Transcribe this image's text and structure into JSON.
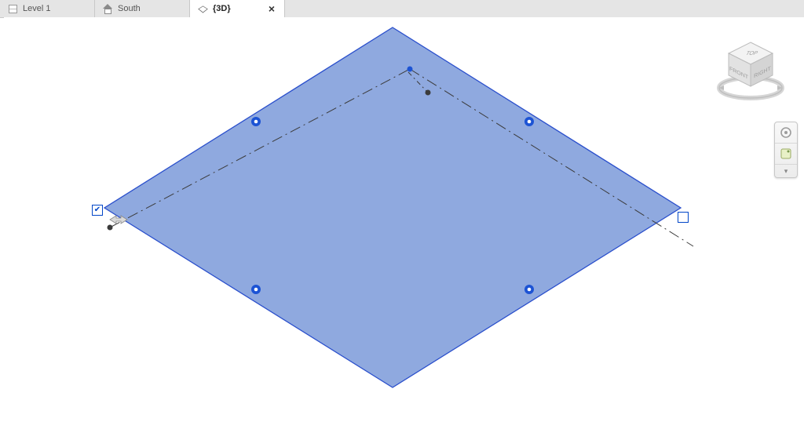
{
  "tabs": [
    {
      "label": "Level 1",
      "icon": "plan",
      "active": false
    },
    {
      "label": "South",
      "icon": "elev",
      "active": false
    },
    {
      "label": "{3D}",
      "icon": "3d",
      "active": true,
      "closeable": true
    }
  ],
  "viewcube": {
    "faces": {
      "top": "TOP",
      "front": "FRONT",
      "right": "RIGHT"
    }
  },
  "navbar": {
    "home_tip": "Home",
    "wheel_tip": "Full Navigation Wheel",
    "expand_tip": "Expand"
  },
  "selection": {
    "checkbox_left_checked": true,
    "checkbox_right_checked": false
  },
  "colors": {
    "floor_fill": "#8fa9df",
    "floor_selected_edge": "#2a4fcc",
    "grip": "#1c53d4"
  }
}
